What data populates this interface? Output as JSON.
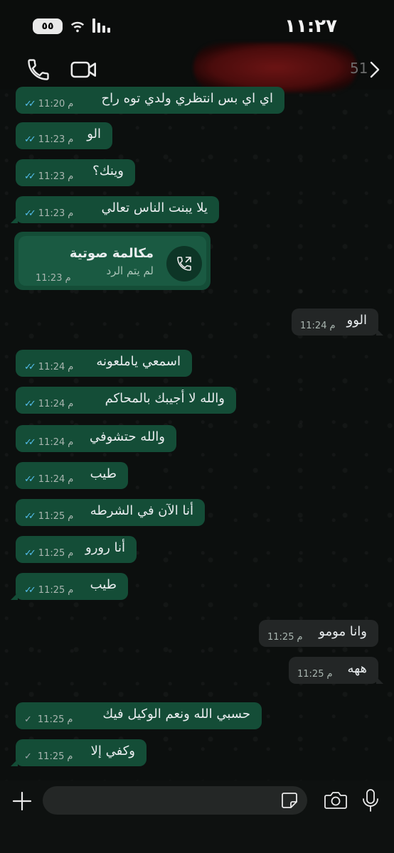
{
  "status_bar": {
    "battery": "٥٥",
    "time": "١١:٢٧"
  },
  "header": {
    "unread_count": "51"
  },
  "messages": [
    {
      "text": "اي اي بس انتظري ولدي توه راح",
      "time": "11:20",
      "ampm": "م",
      "dir": "out",
      "status": "read"
    },
    {
      "text": "الو",
      "time": "11:23",
      "ampm": "م",
      "dir": "out",
      "status": "read"
    },
    {
      "text": "وينك؟",
      "time": "11:23",
      "ampm": "م",
      "dir": "out",
      "status": "read"
    },
    {
      "text": "يلا يبنت الناس تعالي",
      "time": "11:23",
      "ampm": "م",
      "dir": "out",
      "status": "read"
    },
    {
      "text": "الوو",
      "time": "11:24",
      "ampm": "م",
      "dir": "in"
    },
    {
      "text": "اسمعي ياملعونه",
      "time": "11:24",
      "ampm": "م",
      "dir": "out",
      "status": "read"
    },
    {
      "text": "والله لا أجيبك بالمحاكم",
      "time": "11:24",
      "ampm": "م",
      "dir": "out",
      "status": "read"
    },
    {
      "text": "والله حتشوفي",
      "time": "11:24",
      "ampm": "م",
      "dir": "out",
      "status": "read"
    },
    {
      "text": "طيب",
      "time": "11:24",
      "ampm": "م",
      "dir": "out",
      "status": "read"
    },
    {
      "text": "أنا الآن في الشرطه",
      "time": "11:25",
      "ampm": "م",
      "dir": "out",
      "status": "read"
    },
    {
      "text": "أنا رورو",
      "time": "11:25",
      "ampm": "م",
      "dir": "out",
      "status": "read"
    },
    {
      "text": "طيب",
      "time": "11:25",
      "ampm": "م",
      "dir": "out",
      "status": "read"
    },
    {
      "text": "وانا مومو",
      "time": "11:25",
      "ampm": "م",
      "dir": "in"
    },
    {
      "text": "ههه",
      "time": "11:25",
      "ampm": "م",
      "dir": "in"
    },
    {
      "text": "حسبي الله ونعم الوكيل فيك",
      "time": "11:25",
      "ampm": "م",
      "dir": "out",
      "status": "sent"
    },
    {
      "text": "وكفي إلا",
      "time": "11:25",
      "ampm": "م",
      "dir": "out",
      "status": "sent"
    }
  ],
  "call": {
    "title": "مكالمة صوتية",
    "subtitle": "لم يتم الرد",
    "time": "11:23",
    "ampm": "م"
  },
  "colors": {
    "outgoing_bubble": "#144d37",
    "incoming_bubble": "#232626",
    "read_tick": "#53bdeb",
    "background": "#0b0d0c"
  }
}
